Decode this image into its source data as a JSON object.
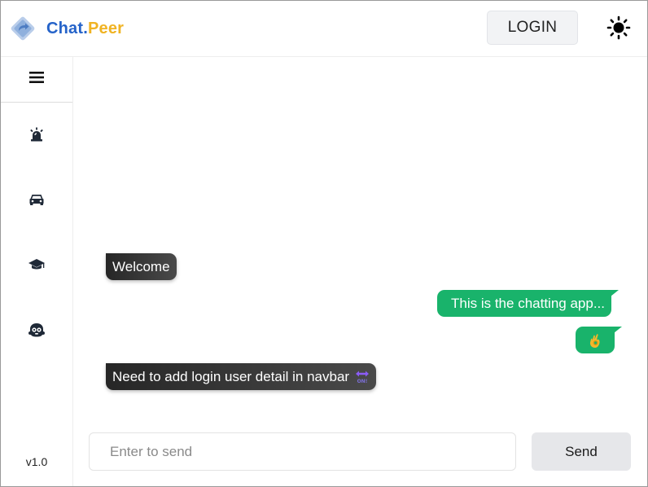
{
  "header": {
    "brand_part1": "Chat.",
    "brand_part2": "Peer",
    "login_label": "LOGIN",
    "theme_icon": "sun-icon"
  },
  "sidebar": {
    "menu_icon": "hamburger-menu-icon",
    "items": [
      {
        "icon": "siren-icon"
      },
      {
        "icon": "car-icon"
      },
      {
        "icon": "graduation-cap-icon"
      },
      {
        "icon": "robot-icon"
      }
    ],
    "version": "v1.0"
  },
  "chat": {
    "messages": [
      {
        "side": "left",
        "text": "Welcome"
      },
      {
        "side": "right",
        "text": "This is the chatting app..."
      },
      {
        "side": "right",
        "text": "",
        "emoji": "ok-hand-emoji"
      },
      {
        "side": "left",
        "text": "Need to add login user detail in navbar",
        "emoji": "on-arrow-emoji"
      }
    ],
    "input_placeholder": "Enter to send",
    "input_value": "",
    "send_label": "Send"
  },
  "colors": {
    "brand_blue": "#2563c9",
    "brand_yellow": "#f0b323",
    "sent_bubble": "#19b36b",
    "received_bubble": "#2f2f2f"
  }
}
